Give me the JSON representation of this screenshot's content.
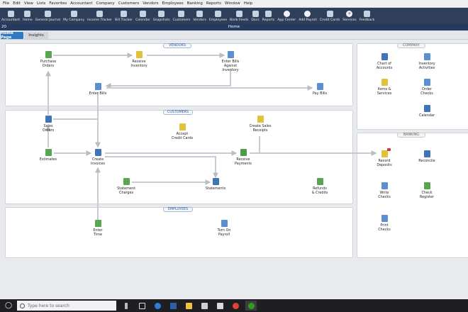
{
  "menu": [
    "File",
    "Edit",
    "View",
    "Lists",
    "Favorites",
    "Accountant",
    "Company",
    "Customers",
    "Vendors",
    "Employees",
    "Banking",
    "Reports",
    "Window",
    "Help"
  ],
  "iconbar": [
    {
      "label": "Accountant",
      "icon": "person-icon"
    },
    {
      "label": "Home",
      "icon": "home-icon"
    },
    {
      "label": "General Journal",
      "icon": "journal-icon"
    },
    {
      "label": "My Company",
      "icon": "company-icon"
    },
    {
      "label": "Income Tracker",
      "icon": "tracker-icon"
    },
    {
      "label": "Bill Tracker",
      "icon": "bill-icon"
    },
    {
      "label": "Calendar",
      "icon": "calendar-icon"
    },
    {
      "label": "Snapshots",
      "icon": "chart-icon"
    },
    {
      "label": "Customers",
      "icon": "customers-icon"
    },
    {
      "label": "Vendors",
      "icon": "vendors-icon"
    },
    {
      "label": "Employees",
      "icon": "employees-icon"
    },
    {
      "label": "Bank Feeds",
      "icon": "bank-icon"
    },
    {
      "label": "Docs",
      "icon": "docs-icon"
    },
    {
      "label": "Reports",
      "icon": "reports-icon"
    },
    {
      "label": "App Center",
      "icon": "app-center-icon"
    },
    {
      "label": "Add Payroll",
      "icon": "payroll-icon"
    },
    {
      "label": "Credit Cards",
      "icon": "credit-card-icon"
    },
    {
      "label": "Services",
      "icon": "services-icon"
    },
    {
      "label": "Feedback",
      "icon": "feedback-icon"
    }
  ],
  "titlebar": {
    "left": "20",
    "title": "Home"
  },
  "tabs": {
    "home": "Home Page",
    "insights": "Insights"
  },
  "sections": {
    "vendors": "VENDORS",
    "customers": "CUSTOMERS",
    "employees": "EMPLOYEES",
    "company": "COMPANY",
    "banking": "BANKING"
  },
  "nodes": {
    "purchase_orders": [
      "Purchase",
      "Orders"
    ],
    "receive_inventory": [
      "Receive",
      "Inventory"
    ],
    "enter_bills_inventory": [
      "Enter Bills",
      "Against",
      "Inventory"
    ],
    "enter_bills": [
      "Enter Bills"
    ],
    "pay_bills": [
      "Pay Bills"
    ],
    "sales_orders": [
      "Sales",
      "Orders"
    ],
    "accept_cc": [
      "Accept",
      "Credit Cards"
    ],
    "create_sales_receipts": [
      "Create Sales",
      "Receipts"
    ],
    "estimates": [
      "Estimates"
    ],
    "create_invoices": [
      "Create",
      "Invoices"
    ],
    "receive_payments": [
      "Receive",
      "Payments"
    ],
    "statement_charges": [
      "Statement",
      "Charges"
    ],
    "statements": [
      "Statements"
    ],
    "refunds_credits": [
      "Refunds",
      "& Credits"
    ],
    "enter_time": [
      "Enter",
      "Time"
    ],
    "turn_on_payroll": [
      "Turn On",
      "Payroll"
    ],
    "chart_of_accounts": [
      "Chart of",
      "Accounts"
    ],
    "inventory_activities": [
      "Inventory",
      "Activities"
    ],
    "items_services": [
      "Items &",
      "Services"
    ],
    "order_checks": [
      "Order",
      "Checks"
    ],
    "calendar": [
      "Calendar"
    ],
    "record_deposits": [
      "Record",
      "Deposits"
    ],
    "reconcile": [
      "Reconcile"
    ],
    "write_checks": [
      "Write",
      "Checks"
    ],
    "check_register": [
      "Check",
      "Register"
    ],
    "print_checks": [
      "Print",
      "Checks"
    ]
  },
  "taskbar": {
    "search_placeholder": "Type here to search"
  },
  "colors": {
    "nav": "#2f3f5a",
    "title": "#253a5e",
    "tab_active": "#2f78c4",
    "arrow": "#c8ccd2",
    "taskbar": "#1f1f23"
  }
}
